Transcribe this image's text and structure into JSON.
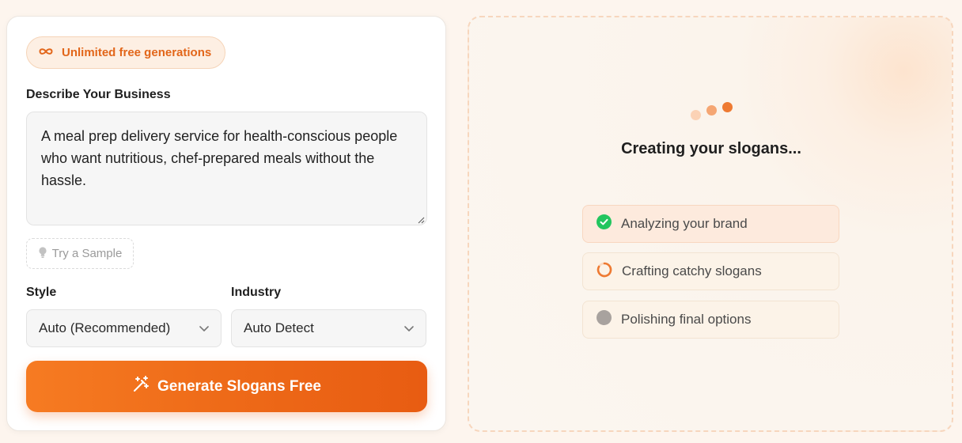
{
  "form": {
    "badge_label": "Unlimited free generations",
    "description_label": "Describe Your Business",
    "description_value": "A meal prep delivery service for health-conscious people who want nutritious, chef-prepared meals without the hassle.",
    "sample_button_label": "Try a Sample",
    "style_label": "Style",
    "style_value": "Auto (Recommended)",
    "industry_label": "Industry",
    "industry_value": "Auto Detect",
    "generate_button_label": "Generate Slogans Free"
  },
  "progress": {
    "title": "Creating your slogans...",
    "steps": [
      {
        "label": "Analyzing your brand",
        "status": "done"
      },
      {
        "label": "Crafting catchy slogans",
        "status": "in-progress"
      },
      {
        "label": "Polishing final options",
        "status": "pending"
      }
    ]
  },
  "colors": {
    "accent": "#ee6a18",
    "success": "#22c55e",
    "pending": "#a8a29e"
  },
  "icons": {
    "badge": "infinity-icon",
    "sample": "lightbulb-icon",
    "select": "chevron-down-icon",
    "generate": "magic-wand-icon"
  }
}
